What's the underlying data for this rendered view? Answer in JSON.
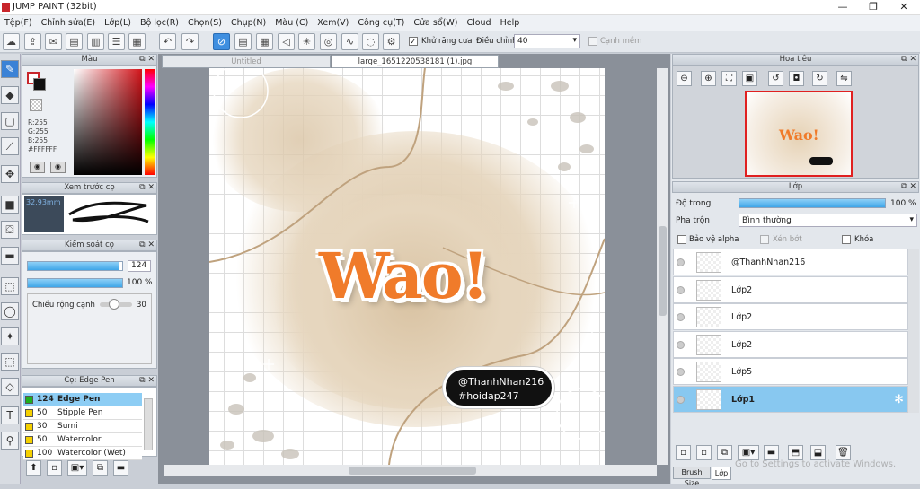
{
  "window": {
    "title": "JUMP PAINT (32bit)",
    "controls": [
      "—",
      "❐",
      "✕"
    ]
  },
  "menu": [
    "Tệp(F)",
    "Chỉnh sửa(E)",
    "Lớp(L)",
    "Bộ lọc(R)",
    "Chọn(S)",
    "Chụp(N)",
    "Màu (C)",
    "Xem(V)",
    "Công cụ(T)",
    "Cửa sổ(W)",
    "Cloud",
    "Help"
  ],
  "toolbar": {
    "antialias_label": "Khử răng cưa",
    "adjust_label": "Điều chỉnh",
    "adjust_value": "40",
    "edge_label": "Cạnh mềm"
  },
  "color_panel": {
    "title": "Màu",
    "r": "R:255",
    "g": "G:255",
    "b": "B:255",
    "hex": "#FFFFFF"
  },
  "brush_preview": {
    "title": "Xem trước cọ",
    "size": "32.93mm"
  },
  "brush_control": {
    "title": "Kiểm soát cọ",
    "size_value": "124",
    "opacity_value": "100 %",
    "width_label": "Chiều rộng cạnh",
    "width_value": "30",
    "size_fraction": 0.97,
    "opacity_fraction": 1.0
  },
  "brush_list": {
    "title": "Cọ: Edge Pen",
    "items": [
      {
        "size": "124",
        "name": "Edge Pen",
        "color": "#1fb01f",
        "selected": true
      },
      {
        "size": "50",
        "name": "Stipple Pen",
        "color": "#f5d000",
        "selected": false
      },
      {
        "size": "30",
        "name": "Sumi",
        "color": "#f5d000",
        "selected": false
      },
      {
        "size": "50",
        "name": "Watercolor",
        "color": "#f5d000",
        "selected": false
      },
      {
        "size": "100",
        "name": "Watercolor (Wet)",
        "color": "#f5d000",
        "selected": false
      }
    ]
  },
  "tabs": {
    "untitled": "Untitled",
    "file": "large_1651220538181 (1).jpg"
  },
  "artwork": {
    "main_text": "Wao!",
    "tag_line1": "@ThanhNhan216",
    "tag_line2": "#hoidap247"
  },
  "navigator": {
    "title": "Hoa tiêu"
  },
  "layers": {
    "title": "Lớp",
    "opacity_label": "Độ trong",
    "opacity_value": "100 %",
    "opacity_fraction": 1.0,
    "blend_label": "Pha trộn",
    "blend_value": "Bình thường",
    "protect_alpha": "Bảo vệ alpha",
    "clip": "Xén bớt",
    "lock": "Khóa",
    "items": [
      {
        "name": "@ThanhNhan216",
        "selected": false
      },
      {
        "name": "Lớp2",
        "selected": false
      },
      {
        "name": "Lớp2",
        "selected": false
      },
      {
        "name": "Lớp2",
        "selected": false
      },
      {
        "name": "Lớp5",
        "selected": false
      },
      {
        "name": "Lớp1",
        "selected": true
      }
    ],
    "tab_brush_size": "Brush Size",
    "tab_layer": "Lớp"
  },
  "watermark": "Go to Settings to activate Windows."
}
